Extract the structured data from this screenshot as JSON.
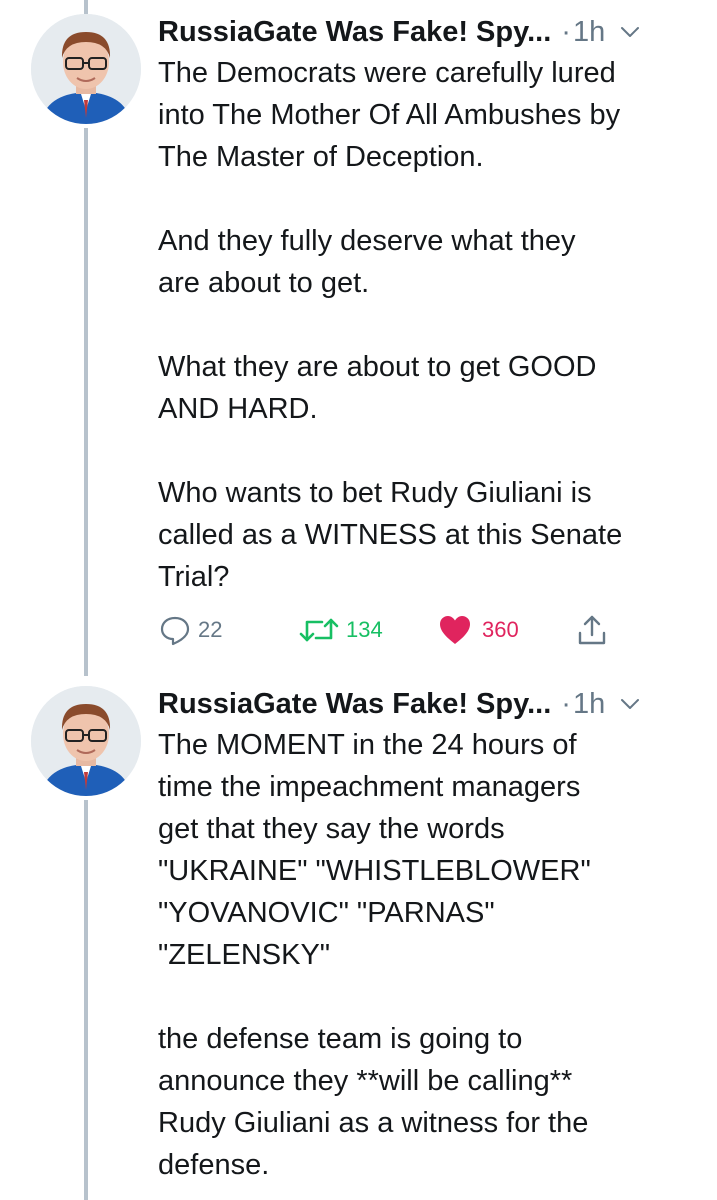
{
  "tweets": [
    {
      "author": "RussiaGate Was Fake! Spy...",
      "separator": "·",
      "time": "1h",
      "text": "The Democrats were carefully lured\ninto The Mother Of All Ambushes by\nThe Master of Deception.\n\nAnd they fully deserve what they\nare about to get.\n\nWhat they are about to get GOOD\nAND HARD.\n\nWho wants to bet Rudy Giuliani is\ncalled as a WITNESS at this Senate\nTrial?",
      "replies": "22",
      "retweets": "134",
      "likes": "360",
      "icons": {
        "reply": "reply-icon",
        "retweet": "retweet-icon",
        "like": "heart-icon",
        "share": "share-icon",
        "menu": "chevron-down-icon"
      }
    },
    {
      "author": "RussiaGate Was Fake! Spy...",
      "separator": "·",
      "time": "1h",
      "text": "The MOMENT in the 24 hours of\ntime the impeachment managers\nget that they say the words\n\"UKRAINE\" \"WHISTLEBLOWER\"\n\"YOVANOVIC\" \"PARNAS\"\n\"ZELENSKY\"\n\nthe defense team is going to\nannounce they **will be calling**\nRudy Giuliani as a witness for the\ndefense.",
      "icons": {
        "menu": "chevron-down-icon"
      }
    }
  ],
  "colors": {
    "text": "#14171a",
    "secondary": "#657786",
    "retweet": "#17bf63",
    "like": "#e0245e",
    "thread_line": "#b7c2cc"
  }
}
